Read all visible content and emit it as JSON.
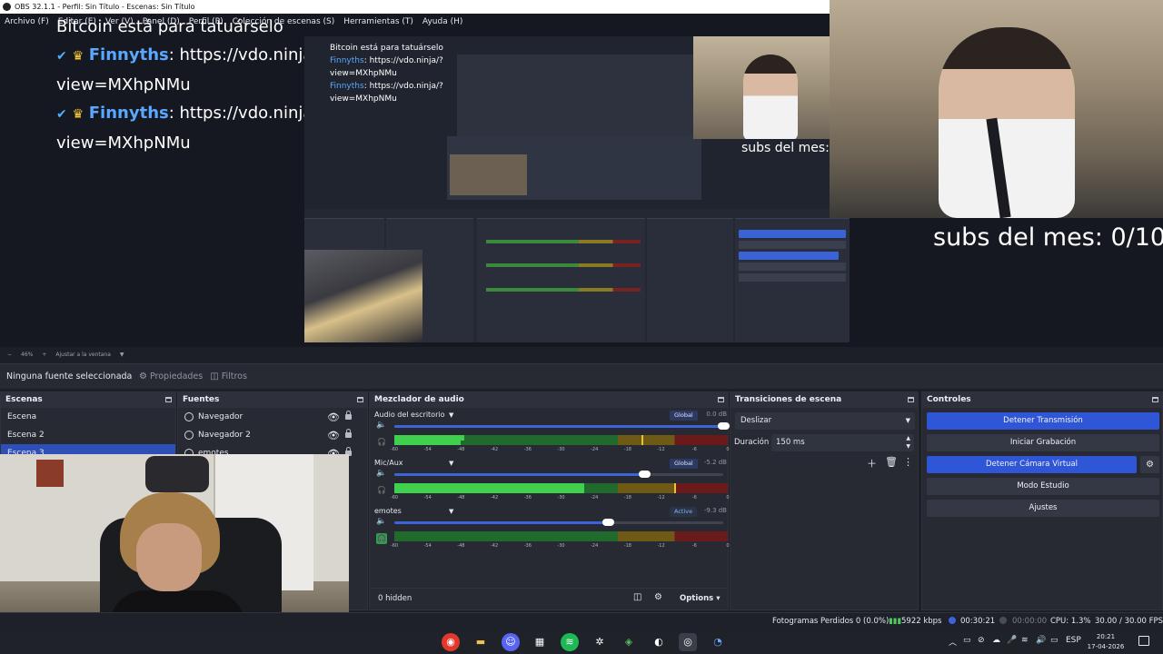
{
  "window": {
    "title": "OBS 32.1.1 - Perfil: Sin Título - Escenas: Sin Título"
  },
  "menu": [
    "Archivo (F)",
    "Editar (E)",
    "Ver (V)",
    "Panel (D)",
    "Perfil (P)",
    "Colección de escenas (S)",
    "Herramientas (T)",
    "Ayuda (H)"
  ],
  "preview": {
    "chat": {
      "top_text": "Bitcoin está para tatuárselo",
      "messages": [
        {
          "user": "Finnyths",
          "text": ": https://vdo.ninja/?",
          "cont": "view=MXhpNMu"
        },
        {
          "user": "Finnyths",
          "text": ": https://vdo.ninja/?",
          "cont": "view=MXhpNMu"
        }
      ]
    },
    "subs_big": "subs del mes: 0/10",
    "subs_small": "subs del mes: 0"
  },
  "zoom": {
    "minus": "−",
    "value": "46%",
    "plus": "+",
    "fit": "Ajustar a la ventana"
  },
  "context": {
    "no_source": "Ninguna fuente seleccionada",
    "properties": "Propiedades",
    "filters": "Filtros"
  },
  "scenes": {
    "title": "Escenas",
    "items": [
      "Escena",
      "Escena 2",
      "Escena 3"
    ]
  },
  "sources": {
    "title": "Fuentes",
    "items": [
      "Navegador",
      "Navegador 2",
      "emotes"
    ]
  },
  "mixer": {
    "title": "Mezclador de audio",
    "channels": [
      {
        "name": "Audio del escritorio",
        "tag": "Global",
        "db": "0.0 dB",
        "volume": 1.0,
        "level": 0.21,
        "level2": 0.2,
        "peak": 0.74,
        "headphone_on": false
      },
      {
        "name": "Mic/Aux",
        "tag": "Global",
        "db": "-5.2 dB",
        "volume": 0.76,
        "level": 0.57,
        "level2": 0.57,
        "peak": 0.84,
        "headphone_on": false
      },
      {
        "name": "emotes",
        "tag": "Active",
        "db": "-9.3 dB",
        "volume": 0.65,
        "level": 0.0,
        "level2": 0.0,
        "peak": 0.0,
        "headphone_on": true
      }
    ],
    "ticks": [
      "-60",
      "-54",
      "-48",
      "-42",
      "-36",
      "-30",
      "-24",
      "-18",
      "-12",
      "-6",
      "0"
    ],
    "hidden": "0 hidden",
    "options": "Options"
  },
  "transitions": {
    "title": "Transiciones de escena",
    "selected": "Deslizar",
    "duration_label": "Duración",
    "duration": "150 ms"
  },
  "controls": {
    "title": "Controles",
    "stop_stream": "Detener Transmisión",
    "start_record": "Iniciar Grabación",
    "stop_vcam": "Detener Cámara Virtual",
    "studio_mode": "Modo Estudio",
    "settings": "Ajustes"
  },
  "status": {
    "dropped": "Fotogramas Perdidos 0 (0.0%)",
    "bitrate": "5922 kbps",
    "live_time": "00:30:21",
    "rec_time": "00:00:00",
    "cpu": "CPU: 1.3%",
    "fps": "30.00 / 30.00 FPS"
  },
  "taskbar": {
    "lang": "ESP",
    "time": "20:21",
    "date": "17-04-2026"
  }
}
